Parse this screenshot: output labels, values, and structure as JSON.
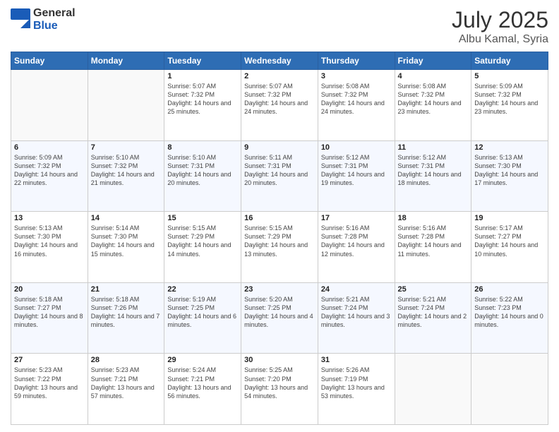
{
  "logo": {
    "general": "General",
    "blue": "Blue"
  },
  "title": {
    "month": "July 2025",
    "location": "Albu Kamal, Syria"
  },
  "days_header": [
    "Sunday",
    "Monday",
    "Tuesday",
    "Wednesday",
    "Thursday",
    "Friday",
    "Saturday"
  ],
  "weeks": [
    [
      {
        "day": "",
        "content": ""
      },
      {
        "day": "",
        "content": ""
      },
      {
        "day": "1",
        "content": "Sunrise: 5:07 AM\nSunset: 7:32 PM\nDaylight: 14 hours and 25 minutes."
      },
      {
        "day": "2",
        "content": "Sunrise: 5:07 AM\nSunset: 7:32 PM\nDaylight: 14 hours and 24 minutes."
      },
      {
        "day": "3",
        "content": "Sunrise: 5:08 AM\nSunset: 7:32 PM\nDaylight: 14 hours and 24 minutes."
      },
      {
        "day": "4",
        "content": "Sunrise: 5:08 AM\nSunset: 7:32 PM\nDaylight: 14 hours and 23 minutes."
      },
      {
        "day": "5",
        "content": "Sunrise: 5:09 AM\nSunset: 7:32 PM\nDaylight: 14 hours and 23 minutes."
      }
    ],
    [
      {
        "day": "6",
        "content": "Sunrise: 5:09 AM\nSunset: 7:32 PM\nDaylight: 14 hours and 22 minutes."
      },
      {
        "day": "7",
        "content": "Sunrise: 5:10 AM\nSunset: 7:32 PM\nDaylight: 14 hours and 21 minutes."
      },
      {
        "day": "8",
        "content": "Sunrise: 5:10 AM\nSunset: 7:31 PM\nDaylight: 14 hours and 20 minutes."
      },
      {
        "day": "9",
        "content": "Sunrise: 5:11 AM\nSunset: 7:31 PM\nDaylight: 14 hours and 20 minutes."
      },
      {
        "day": "10",
        "content": "Sunrise: 5:12 AM\nSunset: 7:31 PM\nDaylight: 14 hours and 19 minutes."
      },
      {
        "day": "11",
        "content": "Sunrise: 5:12 AM\nSunset: 7:31 PM\nDaylight: 14 hours and 18 minutes."
      },
      {
        "day": "12",
        "content": "Sunrise: 5:13 AM\nSunset: 7:30 PM\nDaylight: 14 hours and 17 minutes."
      }
    ],
    [
      {
        "day": "13",
        "content": "Sunrise: 5:13 AM\nSunset: 7:30 PM\nDaylight: 14 hours and 16 minutes."
      },
      {
        "day": "14",
        "content": "Sunrise: 5:14 AM\nSunset: 7:30 PM\nDaylight: 14 hours and 15 minutes."
      },
      {
        "day": "15",
        "content": "Sunrise: 5:15 AM\nSunset: 7:29 PM\nDaylight: 14 hours and 14 minutes."
      },
      {
        "day": "16",
        "content": "Sunrise: 5:15 AM\nSunset: 7:29 PM\nDaylight: 14 hours and 13 minutes."
      },
      {
        "day": "17",
        "content": "Sunrise: 5:16 AM\nSunset: 7:28 PM\nDaylight: 14 hours and 12 minutes."
      },
      {
        "day": "18",
        "content": "Sunrise: 5:16 AM\nSunset: 7:28 PM\nDaylight: 14 hours and 11 minutes."
      },
      {
        "day": "19",
        "content": "Sunrise: 5:17 AM\nSunset: 7:27 PM\nDaylight: 14 hours and 10 minutes."
      }
    ],
    [
      {
        "day": "20",
        "content": "Sunrise: 5:18 AM\nSunset: 7:27 PM\nDaylight: 14 hours and 8 minutes."
      },
      {
        "day": "21",
        "content": "Sunrise: 5:18 AM\nSunset: 7:26 PM\nDaylight: 14 hours and 7 minutes."
      },
      {
        "day": "22",
        "content": "Sunrise: 5:19 AM\nSunset: 7:25 PM\nDaylight: 14 hours and 6 minutes."
      },
      {
        "day": "23",
        "content": "Sunrise: 5:20 AM\nSunset: 7:25 PM\nDaylight: 14 hours and 4 minutes."
      },
      {
        "day": "24",
        "content": "Sunrise: 5:21 AM\nSunset: 7:24 PM\nDaylight: 14 hours and 3 minutes."
      },
      {
        "day": "25",
        "content": "Sunrise: 5:21 AM\nSunset: 7:24 PM\nDaylight: 14 hours and 2 minutes."
      },
      {
        "day": "26",
        "content": "Sunrise: 5:22 AM\nSunset: 7:23 PM\nDaylight: 14 hours and 0 minutes."
      }
    ],
    [
      {
        "day": "27",
        "content": "Sunrise: 5:23 AM\nSunset: 7:22 PM\nDaylight: 13 hours and 59 minutes."
      },
      {
        "day": "28",
        "content": "Sunrise: 5:23 AM\nSunset: 7:21 PM\nDaylight: 13 hours and 57 minutes."
      },
      {
        "day": "29",
        "content": "Sunrise: 5:24 AM\nSunset: 7:21 PM\nDaylight: 13 hours and 56 minutes."
      },
      {
        "day": "30",
        "content": "Sunrise: 5:25 AM\nSunset: 7:20 PM\nDaylight: 13 hours and 54 minutes."
      },
      {
        "day": "31",
        "content": "Sunrise: 5:26 AM\nSunset: 7:19 PM\nDaylight: 13 hours and 53 minutes."
      },
      {
        "day": "",
        "content": ""
      },
      {
        "day": "",
        "content": ""
      }
    ]
  ]
}
